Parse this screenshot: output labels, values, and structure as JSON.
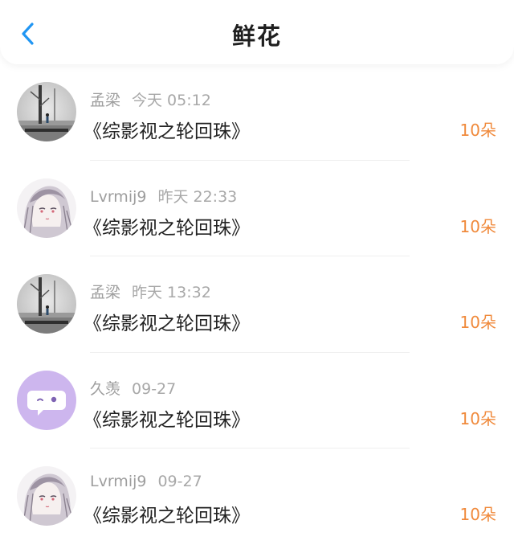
{
  "header": {
    "title": "鲜花",
    "back_icon": "chevron-left-icon",
    "accent_color": "#2196f3"
  },
  "records": [
    {
      "user": "孟梁",
      "time": "今天 05:12",
      "book": "《综影视之轮回珠》",
      "amount": "10朵",
      "avatar": "landscape-avatar"
    },
    {
      "user": "Lvrmij9",
      "time": "昨天 22:33",
      "book": "《综影视之轮回珠》",
      "amount": "10朵",
      "avatar": "anime-girl-avatar"
    },
    {
      "user": "孟梁",
      "time": "昨天 13:32",
      "book": "《综影视之轮回珠》",
      "amount": "10朵",
      "avatar": "landscape-avatar"
    },
    {
      "user": "久羡",
      "time": "09-27",
      "book": "《综影视之轮回珠》",
      "amount": "10朵",
      "avatar": "chat-bubble-avatar"
    },
    {
      "user": "Lvrmij9",
      "time": "09-27",
      "book": "《综影视之轮回珠》",
      "amount": "10朵",
      "avatar": "anime-girl-avatar"
    }
  ]
}
